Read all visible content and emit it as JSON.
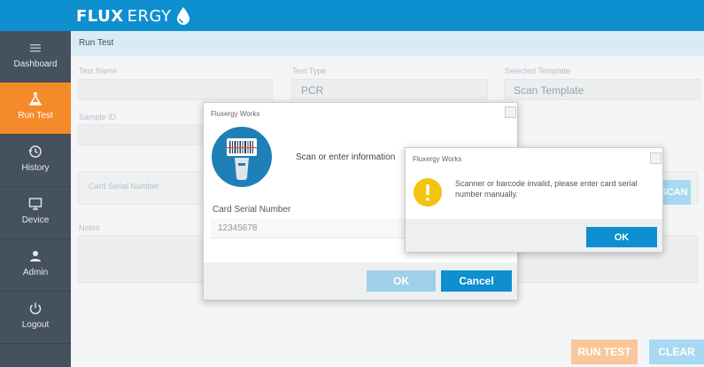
{
  "brand": {
    "name_bold": "FLUX",
    "name_rest": "ERGY"
  },
  "colors": {
    "topbar": "#0e8fcf",
    "sidebar": "#45525e",
    "active": "#f58a2a",
    "primary": "#0e8fcf",
    "warning": "#f1c40f"
  },
  "sidebar": {
    "items": [
      {
        "label": "Dashboard",
        "icon": "menu-icon"
      },
      {
        "label": "Run Test",
        "icon": "flask-icon",
        "active": true
      },
      {
        "label": "History",
        "icon": "history-icon"
      },
      {
        "label": "Device",
        "icon": "monitor-icon"
      },
      {
        "label": "Admin",
        "icon": "user-icon"
      },
      {
        "label": "Logout",
        "icon": "power-icon"
      }
    ]
  },
  "main": {
    "breadcrumb": "Run Test",
    "form": {
      "test_name_label": "Test Name",
      "test_type_label": "Test Type",
      "test_type_value": "PCR",
      "template_label": "Selected Template",
      "template_value": "Scan Template",
      "sample_id_label": "Sample ID",
      "card_serial_label": "Card Serial Number",
      "notes_label": "Notes",
      "scan_button": "SCAN"
    },
    "run_test_button": "RUN TEST",
    "clear_button": "CLEAR"
  },
  "scan_dialog": {
    "title": "Fluxergy Works",
    "message": "Scan or enter information",
    "field_label": "Card Serial Number",
    "field_value": "12345678",
    "ok_button": "OK",
    "cancel_button": "Cancel"
  },
  "error_dialog": {
    "title": "Fluxergy Works",
    "message": "Scanner or barcode invalid, please enter card serial number manually.",
    "ok_button": "OK"
  }
}
